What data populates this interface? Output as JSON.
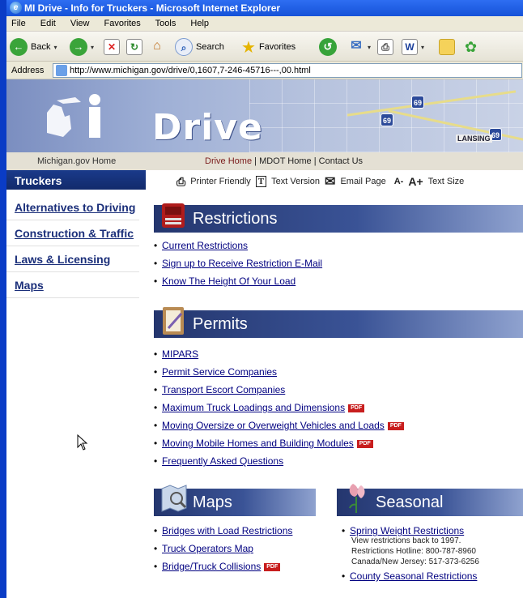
{
  "window": {
    "title": "MI Drive - Info for Truckers - Microsoft Internet Explorer"
  },
  "menu": [
    "File",
    "Edit",
    "View",
    "Favorites",
    "Tools",
    "Help"
  ],
  "toolbar": {
    "back_label": "Back",
    "search_label": "Search",
    "favorites_label": "Favorites"
  },
  "address": {
    "label": "Address",
    "url": "http://www.michigan.gov/drive/0,1607,7-246-45716---,00.html"
  },
  "banner": {
    "logo_text": "Mi",
    "site_word": "Drive",
    "map_label": "LANSING"
  },
  "nav": {
    "mg_home": "Michigan.gov Home",
    "drive_home": "Drive Home",
    "sep1": " | ",
    "mdot_home": "MDOT Home",
    "sep2": " | ",
    "contact": "Contact Us"
  },
  "sidebar": {
    "heading": "Truckers",
    "items": [
      {
        "label": "Alternatives to Driving"
      },
      {
        "label": "Construction & Traffic"
      },
      {
        "label": "Laws & Licensing"
      },
      {
        "label": "Maps"
      }
    ]
  },
  "utility": {
    "printer": "Printer Friendly",
    "text_version": "Text Version",
    "email": "Email Page",
    "text_size_small": "A-",
    "text_size_big": "A+",
    "text_size": "Text Size"
  },
  "restrictions": {
    "title": "Restrictions",
    "links": [
      "Current Restrictions",
      "Sign up to Receive Restriction E-Mail",
      "Know The Height Of Your Load"
    ]
  },
  "permits": {
    "title": "Permits",
    "links": [
      {
        "label": "MIPARS",
        "pdf": false
      },
      {
        "label": "Permit Service Companies",
        "pdf": false
      },
      {
        "label": "Transport Escort Companies",
        "pdf": false
      },
      {
        "label": "Maximum Truck Loadings and Dimensions",
        "pdf": true
      },
      {
        "label": "Moving Oversize or Overweight Vehicles and Loads",
        "pdf": true
      },
      {
        "label": "Moving Mobile Homes and Building Modules",
        "pdf": true
      },
      {
        "label": "Frequently Asked Questions",
        "pdf": false
      }
    ]
  },
  "maps": {
    "title": "Maps",
    "links": [
      {
        "label": "Bridges with Load Restrictions",
        "pdf": false
      },
      {
        "label": "Truck Operators Map",
        "pdf": false
      },
      {
        "label": "Bridge/Truck Collisions",
        "pdf": true
      }
    ]
  },
  "seasonal": {
    "title": "Seasonal",
    "spring_link": "Spring Weight Restrictions",
    "note1": "View restrictions back to 1997.",
    "note2": "Restrictions Hotline: 800-787-8960",
    "note3": "Canada/New Jersey: 517-373-6256",
    "county_link": "County Seasonal Restrictions"
  },
  "pdf_badge": "PDF",
  "bullet": "•"
}
